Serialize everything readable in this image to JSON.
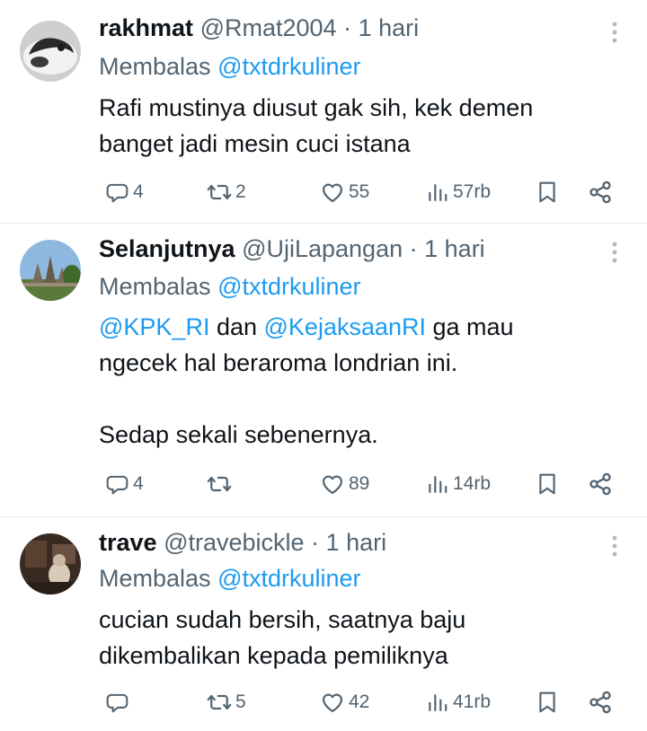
{
  "tweets": [
    {
      "name": "rakhmat",
      "handle": "@Rmat2004",
      "separator": "·",
      "time": "1 hari",
      "reply_prefix": "Membalas",
      "reply_to": "@txtdrkuliner",
      "body_lines": [
        "Rafi mustinya diusut gak sih, kek demen",
        "banget jadi mesin cuci istana"
      ],
      "replies": "4",
      "retweets": "2",
      "likes": "55",
      "views": "57rb"
    },
    {
      "name": "Selanjutnya",
      "handle": "@UjiLapangan",
      "separator": "·",
      "time": "1 hari",
      "reply_prefix": "Membalas",
      "reply_to": "@txtdrkuliner",
      "body_mention_1": "@KPK_RI",
      "body_text_1": " dan ",
      "body_mention_2": "@KejaksaanRI",
      "body_text_2": " ga mau",
      "body_line_2": "ngecek hal beraroma londrian ini.",
      "body_line_3": "Sedap sekali sebenernya.",
      "replies": "4",
      "retweets": "",
      "likes": "89",
      "views": "14rb"
    },
    {
      "name": "trave",
      "handle": "@travebickle",
      "separator": "·",
      "time": "1 hari",
      "reply_prefix": "Membalas",
      "reply_to": "@txtdrkuliner",
      "body_lines": [
        "cucian sudah bersih, saatnya baju",
        "dikembalikan kepada pemiliknya"
      ],
      "replies": "",
      "retweets": "5",
      "likes": "42",
      "views": "41rb"
    }
  ],
  "icons": {
    "more": "more-vertical-icon",
    "reply": "reply-icon",
    "retweet": "retweet-icon",
    "like": "heart-icon",
    "views": "views-icon",
    "bookmark": "bookmark-icon",
    "share": "share-icon"
  },
  "colors": {
    "text": "#0f1419",
    "secondary": "#536471",
    "link": "#1d9bf0",
    "divider": "#e6ecf0"
  }
}
